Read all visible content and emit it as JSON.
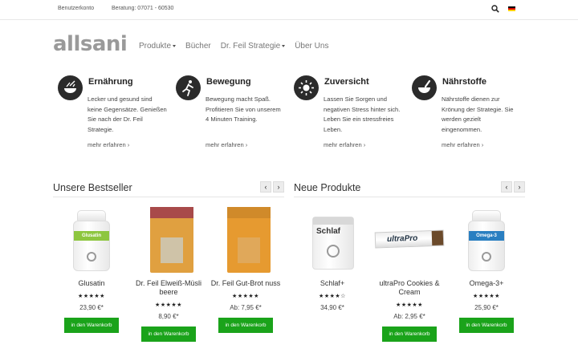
{
  "topbar": {
    "account": "Benutzerkonto",
    "phone": "Beratung: 07071 - 60530"
  },
  "logo": "allsani",
  "nav": [
    "Produkte",
    "Bücher",
    "Dr. Feil Strategie",
    "Über Uns"
  ],
  "features": [
    {
      "title": "Ernährung",
      "text": "Lecker und gesund sind keine Gegensätze. Genießen Sie nach der Dr. Feil Strategie.",
      "more": "mehr erfahren ›",
      "icon": "bowl-icon"
    },
    {
      "title": "Bewegung",
      "text": "Bewegung macht Spaß. Profitieren Sie von unserem 4 Minuten Training.",
      "more": "mehr erfahren ›",
      "icon": "running-icon"
    },
    {
      "title": "Zuversicht",
      "text": "Lassen Sie Sorgen und negativen Stress hinter sich. Leben Sie ein stressfreies Leben.",
      "more": "mehr erfahren ›",
      "icon": "sun-icon"
    },
    {
      "title": "Nährstoffe",
      "text": "Nährstoffe dienen zur Krönung der Strategie. Sie werden gezielt eingenommen.",
      "more": "mehr erfahren ›",
      "icon": "mortar-icon"
    }
  ],
  "bestseller": {
    "title": "Unsere Bestseller",
    "products": [
      {
        "name": "Glusatin",
        "stars": "★★★★★",
        "price": "23,90 €*",
        "button": "in den Warenkorb",
        "band": "Glusatin",
        "rating": 4.5
      },
      {
        "name": "Dr. Feil Elweiß-Müsli beere",
        "stars": "★★★★★",
        "price": "8,90 €*",
        "button": "in den Warenkorb",
        "rating": 4.5
      },
      {
        "name": "Dr. Feil Gut-Brot nuss",
        "stars": "★★★★★",
        "price": "Ab: 7,95 €*",
        "button": "in den Warenkorb",
        "rating": 4.5
      }
    ]
  },
  "neue": {
    "title": "Neue Produkte",
    "products": [
      {
        "name": "Schlaf+",
        "stars": "★★★★☆",
        "price": "34,90 €*",
        "button": "in den Warenkorb",
        "label": "Schlaf",
        "rating": 4
      },
      {
        "name": "ultraPro Cookies & Cream",
        "stars": "★★★★★",
        "price": "Ab: 2,95 €*",
        "button": "in den Warenkorb",
        "label": "ultraPro",
        "rating": 4.5
      },
      {
        "name": "Omega-3+",
        "stars": "★★★★★",
        "price": "25,90 €*",
        "button": "in den Warenkorb",
        "band": "Omega-3",
        "rating": 4.5
      }
    ]
  },
  "arrows": {
    "prev": "‹",
    "next": "›"
  },
  "colors": {
    "accent": "#1aa31a",
    "icon_bg": "#2b2b2b",
    "glusatin_band": "#8dc63f",
    "omega_band": "#2a7fc1"
  }
}
